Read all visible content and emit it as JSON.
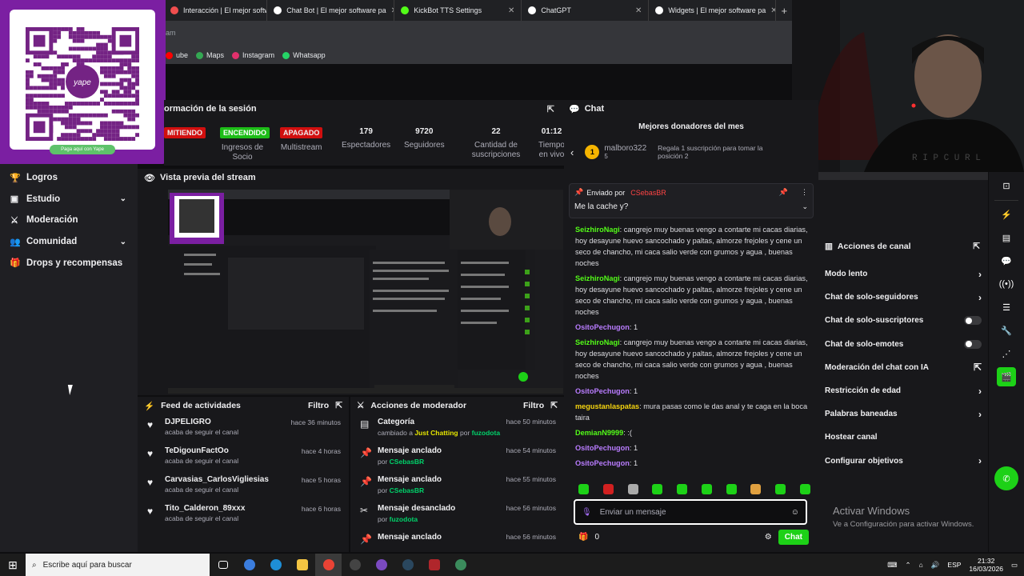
{
  "browser": {
    "tabs": [
      {
        "label": "Interacción | El mejor softwa",
        "color": "#f04e4e"
      },
      {
        "label": "Chat Bot | El mejor software pa",
        "color": "#ffffff"
      },
      {
        "label": "KickBot TTS Settings",
        "color": "#53fc18"
      },
      {
        "label": "ChatGPT",
        "color": "#ffffff"
      },
      {
        "label": "Widgets | El mejor software pa",
        "color": "#ffffff"
      }
    ],
    "tab_close": "✕",
    "new_tab": "+",
    "address_fragment": "am",
    "bookmarks": [
      {
        "label": "ube",
        "color": "#ff0000"
      },
      {
        "label": "Maps",
        "color": "#34a853"
      },
      {
        "label": "Instagram",
        "color": "#e1306c"
      },
      {
        "label": "Whatsapp",
        "color": "#25d366"
      }
    ]
  },
  "qr": {
    "brand": "yape",
    "caption": "Paga aquí con Yape"
  },
  "session": {
    "title": "ormación de la sesión",
    "stats": [
      {
        "pill": "MITIENDO",
        "pill_color": "#d10f0f",
        "label": ""
      },
      {
        "pill": "ENCENDIDO",
        "pill_color": "#1dbd17",
        "label": "Ingresos de Socio"
      },
      {
        "pill": "APAGADO",
        "pill_color": "#d10f0f",
        "label": "Multistream"
      },
      {
        "value": "179",
        "label": "Espectadores"
      },
      {
        "value": "9720",
        "label": "Seguidores"
      },
      {
        "value": "22",
        "label": "Cantidad de suscripciones"
      },
      {
        "value": "01:12",
        "label": "Tiempo en vivo"
      }
    ]
  },
  "nav": {
    "items": [
      {
        "label": "Logros",
        "icon": "trophy-icon",
        "glyph": "🏆",
        "chevron": false
      },
      {
        "label": "Estudio",
        "icon": "studio-icon",
        "glyph": "▣",
        "chevron": true
      },
      {
        "label": "Moderación",
        "icon": "sword-icon",
        "glyph": "⚔",
        "chevron": false
      },
      {
        "label": "Comunidad",
        "icon": "people-icon",
        "glyph": "👥",
        "chevron": true
      },
      {
        "label": "Drops y recompensas",
        "icon": "gift-icon",
        "glyph": "🎁",
        "chevron": false
      }
    ]
  },
  "preview": {
    "title": "Vista previa del stream"
  },
  "feed": {
    "title": "Feed de actividades",
    "filter": "Filtro",
    "rows": [
      {
        "name": "DJPELIGRO",
        "sub": "acaba de seguir el canal",
        "time": "hace 36 minutos"
      },
      {
        "name": "TeDigounFactOo",
        "sub": "acaba de seguir el canal",
        "time": "hace 4 horas"
      },
      {
        "name": "Carvasias_CarlosVigliesias",
        "sub": "acaba de seguir el canal",
        "time": "hace 5 horas"
      },
      {
        "name": "Tito_Calderon_89xxx",
        "sub": "acaba de seguir el canal",
        "time": "hace 6 horas"
      }
    ]
  },
  "modactions": {
    "title": "Acciones de moderador",
    "filter": "Filtro",
    "rows": [
      {
        "name": "Categoría",
        "pre": "cambiado a ",
        "hl": "Just Chatting",
        "mid": " por ",
        "user": "fuzodota",
        "time": "hace 50 minutos",
        "glyph": "▤"
      },
      {
        "name": "Mensaje anclado",
        "pre": "por ",
        "hl": "",
        "mid": "",
        "user": "CSebasBR",
        "time": "hace 54 minutos",
        "glyph": "📌"
      },
      {
        "name": "Mensaje anclado",
        "pre": "por ",
        "hl": "",
        "mid": "",
        "user": "CSebasBR",
        "time": "hace 55 minutos",
        "glyph": "📌"
      },
      {
        "name": "Mensaje desanclado",
        "pre": "por ",
        "hl": "",
        "mid": "",
        "user": "fuzodota",
        "time": "hace 56 minutos",
        "glyph": "✂"
      },
      {
        "name": "Mensaje anclado",
        "pre": "",
        "hl": "",
        "mid": "",
        "user": "",
        "time": "hace 56 minutos",
        "glyph": "📌"
      }
    ]
  },
  "chat": {
    "title": "Chat",
    "donors_title": "Mejores donadores del mes",
    "donor": {
      "rank": "1",
      "name": "malboro322",
      "count": "5",
      "message": "Regala 1 suscripción para tomar la posición 2"
    },
    "pinned": {
      "label": "Enviado por",
      "user": "CSebasBR",
      "message": "Me la cache y?"
    },
    "lines": [
      {
        "user": "SeizhiroNagi",
        "color": "#53fc18",
        "text": "cangrejo muy buenas vengo a contarte mi cacas diarias, hoy desayune huevo sancochado y paltas, almorze frejoles y cene un seco de chancho, mi caca salio verde con grumos y agua , buenas noches"
      },
      {
        "user": "SeizhiroNagi",
        "color": "#53fc18",
        "text": "cangrejo muy buenas vengo a contarte mi cacas diarias, hoy desayune huevo sancochado y paltas, almorze frejoles y cene un seco de chancho, mi caca salio verde con grumos y agua , buenas noches"
      },
      {
        "user": "OsitoPechugon",
        "color": "#b97cff",
        "text": "1"
      },
      {
        "user": "SeizhiroNagi",
        "color": "#53fc18",
        "text": "cangrejo muy buenas vengo a contarte mi cacas diarias, hoy desayune huevo sancochado y paltas, almorze frejoles y cene un seco de chancho, mi caca salio verde con grumos y agua , buenas noches"
      },
      {
        "user": "OsitoPechugon",
        "color": "#b97cff",
        "text": "1"
      },
      {
        "user": "megustanlaspatas",
        "color": "#f5d40f",
        "text": "mura pasas como le das anal y te caga en la boca taira"
      },
      {
        "user": "DemianN9999",
        "color": "#53fc18",
        "text": ":("
      },
      {
        "user": "OsitoPechugon",
        "color": "#b97cff",
        "text": "1"
      },
      {
        "user": "OsitoPechugon",
        "color": "#b97cff",
        "text": "1"
      }
    ],
    "emote_colors": [
      "#1dd117",
      "#d12020",
      "#aaaaaa",
      "#1dd117",
      "#1dd117",
      "#1dd117",
      "#1dd117",
      "#e0a040",
      "#1dd117",
      "#1dd117"
    ],
    "input_placeholder": "Enviar un mensaje",
    "points": "0",
    "send_label": "Chat"
  },
  "channel_actions": {
    "title": "Acciones de canal",
    "items": [
      {
        "label": "Modo lento",
        "control": "chevron"
      },
      {
        "label": "Chat de solo-seguidores",
        "control": "chevron"
      },
      {
        "label": "Chat de solo-suscriptores",
        "control": "toggle"
      },
      {
        "label": "Chat de solo-emotes",
        "control": "toggle"
      },
      {
        "label": "Moderación del chat con IA",
        "control": "external"
      },
      {
        "label": "Restricción de edad",
        "control": "chevron"
      },
      {
        "label": "Palabras baneadas",
        "control": "chevron"
      },
      {
        "label": "Hostear canal",
        "control": "none"
      },
      {
        "label": "Configurar objetivos",
        "control": "chevron"
      }
    ]
  },
  "activate_windows": {
    "title": "Activar Windows",
    "subtitle": "Ve a Configuración para activar Windows."
  },
  "taskbar": {
    "search_placeholder": "Escribe aquí para buscar",
    "lang": "ESP",
    "time": "21:32",
    "date": "16/03/2026"
  }
}
